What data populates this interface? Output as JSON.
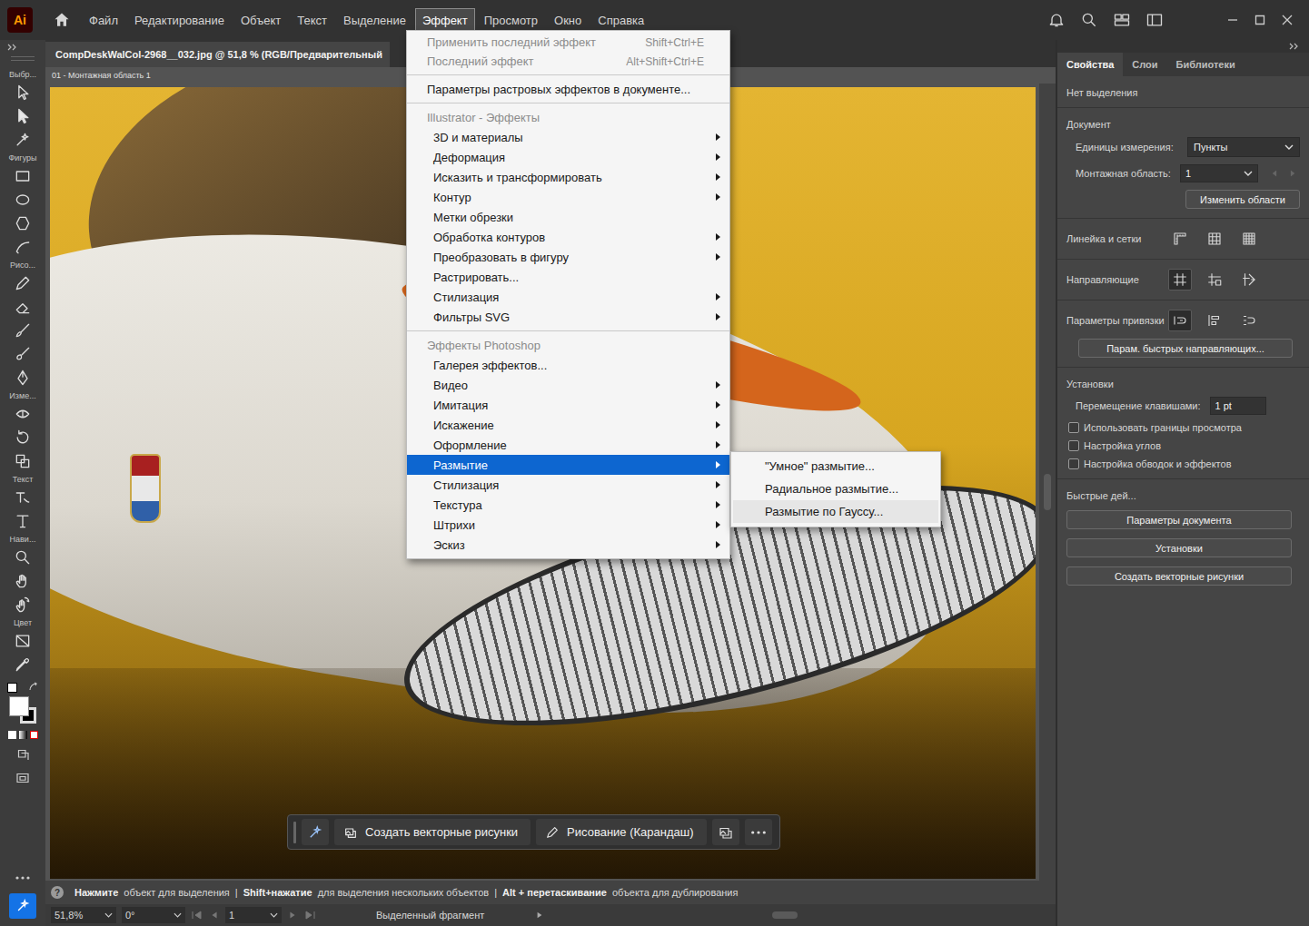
{
  "app": {
    "logo": "Ai"
  },
  "menubar": [
    {
      "label": "Файл",
      "selected": false
    },
    {
      "label": "Редактирование",
      "selected": false
    },
    {
      "label": "Объект",
      "selected": false
    },
    {
      "label": "Текст",
      "selected": false
    },
    {
      "label": "Выделение",
      "selected": false
    },
    {
      "label": "Эффект",
      "selected": true
    },
    {
      "label": "Просмотр",
      "selected": false
    },
    {
      "label": "Окно",
      "selected": false
    },
    {
      "label": "Справка",
      "selected": false
    }
  ],
  "document": {
    "tab_title": "CompDeskWalCol-2968__032.jpg @ 51,8 % (RGB/Предварительный",
    "artboard_label": "01 - Монтажная область 1"
  },
  "toolbar": {
    "group_labels": [
      "Выбр...",
      "Фигуры",
      "Рисо...",
      "Изме...",
      "Текст",
      "Нави...",
      "Цвет"
    ]
  },
  "effect_menu": {
    "sections": [
      {
        "items": [
          {
            "label": "Применить последний эффект",
            "shortcut": "Shift+Ctrl+E",
            "disabled": true,
            "submenu": false,
            "selected": false
          },
          {
            "label": "Последний эффект",
            "shortcut": "Alt+Shift+Ctrl+E",
            "disabled": true,
            "submenu": false,
            "selected": false
          }
        ]
      },
      {
        "items": [
          {
            "label": "Параметры растровых эффектов в документе...",
            "disabled": false,
            "submenu": false,
            "selected": false
          }
        ]
      },
      {
        "header": "Illustrator - Эффекты",
        "items": [
          {
            "label": "3D и материалы",
            "disabled": false,
            "submenu": true,
            "selected": false
          },
          {
            "label": "Деформация",
            "disabled": false,
            "submenu": true,
            "selected": false
          },
          {
            "label": "Исказить и трансформировать",
            "disabled": false,
            "submenu": true,
            "selected": false
          },
          {
            "label": "Контур",
            "disabled": false,
            "submenu": true,
            "selected": false
          },
          {
            "label": "Метки обрезки",
            "disabled": false,
            "submenu": false,
            "selected": false
          },
          {
            "label": "Обработка контуров",
            "disabled": false,
            "submenu": true,
            "selected": false
          },
          {
            "label": "Преобразовать в фигуру",
            "disabled": false,
            "submenu": true,
            "selected": false
          },
          {
            "label": "Растрировать...",
            "disabled": false,
            "submenu": false,
            "selected": false
          },
          {
            "label": "Стилизация",
            "disabled": false,
            "submenu": true,
            "selected": false
          },
          {
            "label": "Фильтры SVG",
            "disabled": false,
            "submenu": true,
            "selected": false
          }
        ]
      },
      {
        "header": "Эффекты Photoshop",
        "items": [
          {
            "label": "Галерея эффектов...",
            "disabled": false,
            "submenu": false,
            "selected": false
          },
          {
            "label": "Видео",
            "disabled": false,
            "submenu": true,
            "selected": false
          },
          {
            "label": "Имитация",
            "disabled": false,
            "submenu": true,
            "selected": false
          },
          {
            "label": "Искажение",
            "disabled": false,
            "submenu": true,
            "selected": false
          },
          {
            "label": "Оформление",
            "disabled": false,
            "submenu": true,
            "selected": false
          },
          {
            "label": "Размытие",
            "disabled": false,
            "submenu": true,
            "selected": true
          },
          {
            "label": "Стилизация",
            "disabled": false,
            "submenu": true,
            "selected": false
          },
          {
            "label": "Текстура",
            "disabled": false,
            "submenu": true,
            "selected": false
          },
          {
            "label": "Штрихи",
            "disabled": false,
            "submenu": true,
            "selected": false
          },
          {
            "label": "Эскиз",
            "disabled": false,
            "submenu": true,
            "selected": false
          }
        ]
      }
    ]
  },
  "blur_submenu": {
    "items": [
      {
        "label": "\"Умное\" размытие...",
        "selected": false
      },
      {
        "label": "Радиальное размытие...",
        "selected": false
      },
      {
        "label": "Размытие по Гауссу...",
        "selected": true
      }
    ]
  },
  "taskbar": {
    "buttons": [
      "Создать векторные рисунки",
      "Рисование (Карандаш)"
    ]
  },
  "hint": {
    "help_icon": "?",
    "separator": "|",
    "segments": [
      {
        "bold": "Нажмите",
        "rest": "объект для выделения"
      },
      {
        "bold": "Shift+нажатие",
        "rest": "для выделения нескольких объектов"
      },
      {
        "bold": "Alt + перетаскивание",
        "rest": "объекта для дублирования"
      }
    ]
  },
  "status_bar": {
    "zoom": "51,8%",
    "rotation": "0°",
    "artboard": "1",
    "info": "Выделенный фрагмент"
  },
  "properties_panel": {
    "tabs": [
      {
        "label": "Свойства",
        "selected": true
      },
      {
        "label": "Слои",
        "selected": false
      },
      {
        "label": "Библиотеки",
        "selected": false
      }
    ],
    "no_selection": "Нет выделения",
    "document_title": "Документ",
    "units": {
      "label": "Единицы измерения:",
      "value": "Пункты"
    },
    "artboard": {
      "label": "Монтажная область:",
      "value": "1"
    },
    "edit_artboards_button": "Изменить области",
    "icon_rows": [
      {
        "label": "Линейка и сетки",
        "toggles": [
          {
            "selected": false
          },
          {
            "selected": false
          },
          {
            "selected": false
          }
        ]
      },
      {
        "label": "Направляющие",
        "toggles": [
          {
            "selected": true
          },
          {
            "selected": false
          },
          {
            "selected": false
          }
        ]
      },
      {
        "label": "Параметры привязки",
        "toggles": [
          {
            "selected": true
          },
          {
            "selected": false
          },
          {
            "selected": false
          }
        ]
      }
    ],
    "smart_guides_button": "Парам. быстрых направляющих...",
    "preferences": {
      "title": "Установки",
      "nudge": {
        "label": "Перемещение клавишами:",
        "value": "1 pt"
      },
      "checkboxes": [
        {
          "label": "Использовать границы просмотра",
          "checked": false
        },
        {
          "label": "Настройка углов",
          "checked": false
        },
        {
          "label": "Настройка обводок и эффектов",
          "checked": false
        }
      ]
    },
    "quick_actions": {
      "title": "Быстрые дей...",
      "buttons": [
        "Параметры документа",
        "Установки",
        "Создать векторные рисунки"
      ]
    }
  }
}
